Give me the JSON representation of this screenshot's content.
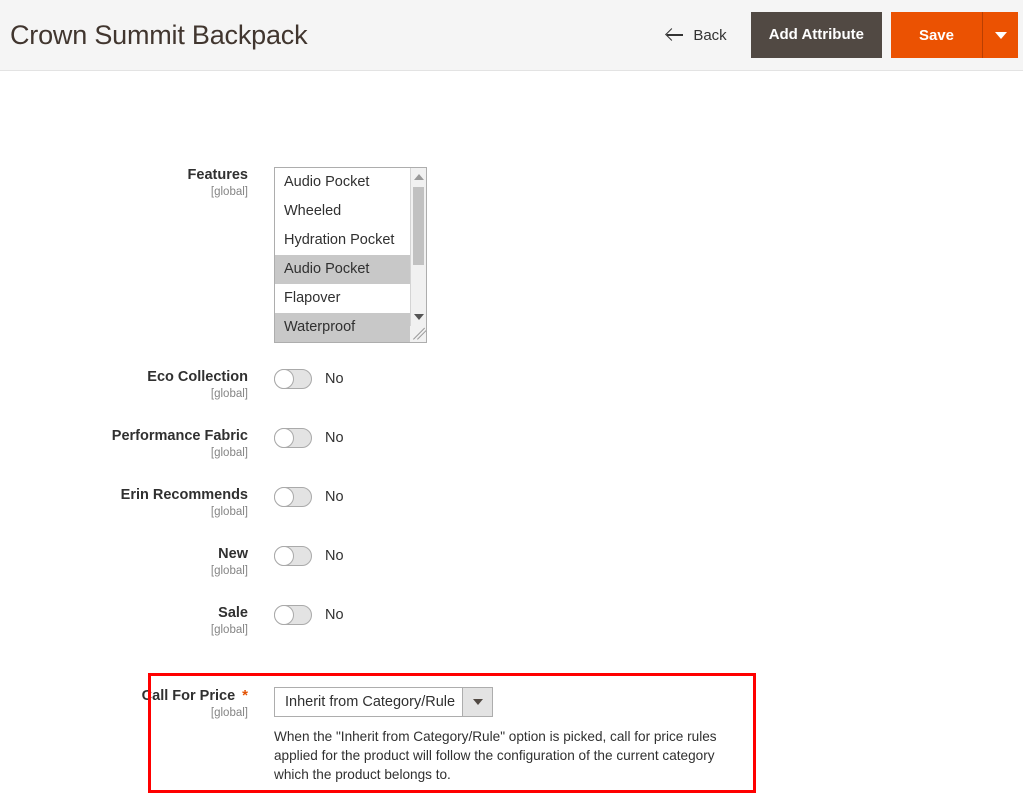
{
  "header": {
    "title": "Crown Summit Backpack",
    "back_label": "Back",
    "add_attribute_label": "Add Attribute",
    "save_label": "Save",
    "colors": {
      "save_button": "#eb5202",
      "add_attribute_button": "#514943",
      "header_background": "#f5f5f5",
      "highlight_border": "#ff0000",
      "required_asterisk": "#e25203"
    }
  },
  "form": {
    "scope_tag": "[global]",
    "features": {
      "label": "Features",
      "scope": "[global]",
      "options": [
        {
          "label": "Audio Pocket",
          "selected": false
        },
        {
          "label": "Wheeled",
          "selected": false
        },
        {
          "label": "Hydration Pocket",
          "selected": false
        },
        {
          "label": "Audio Pocket",
          "selected": true
        },
        {
          "label": "Flapover",
          "selected": false
        },
        {
          "label": "Waterproof",
          "selected": true
        }
      ]
    },
    "toggles": [
      {
        "label": "Eco Collection",
        "scope": "[global]",
        "value": "No",
        "on": false
      },
      {
        "label": "Performance Fabric",
        "scope": "[global]",
        "value": "No",
        "on": false
      },
      {
        "label": "Erin Recommends",
        "scope": "[global]",
        "value": "No",
        "on": false
      },
      {
        "label": "New",
        "scope": "[global]",
        "value": "No",
        "on": false
      },
      {
        "label": "Sale",
        "scope": "[global]",
        "value": "No",
        "on": false
      }
    ],
    "call_for_price": {
      "label": "Call For Price",
      "scope": "[global]",
      "required_marker": "*",
      "selected_option": "Inherit from Category/Rule",
      "note": "When the \"Inherit from Category/Rule\" option is picked, call for price rules applied for the product will follow the configuration of the current category which the product belongs to."
    }
  }
}
